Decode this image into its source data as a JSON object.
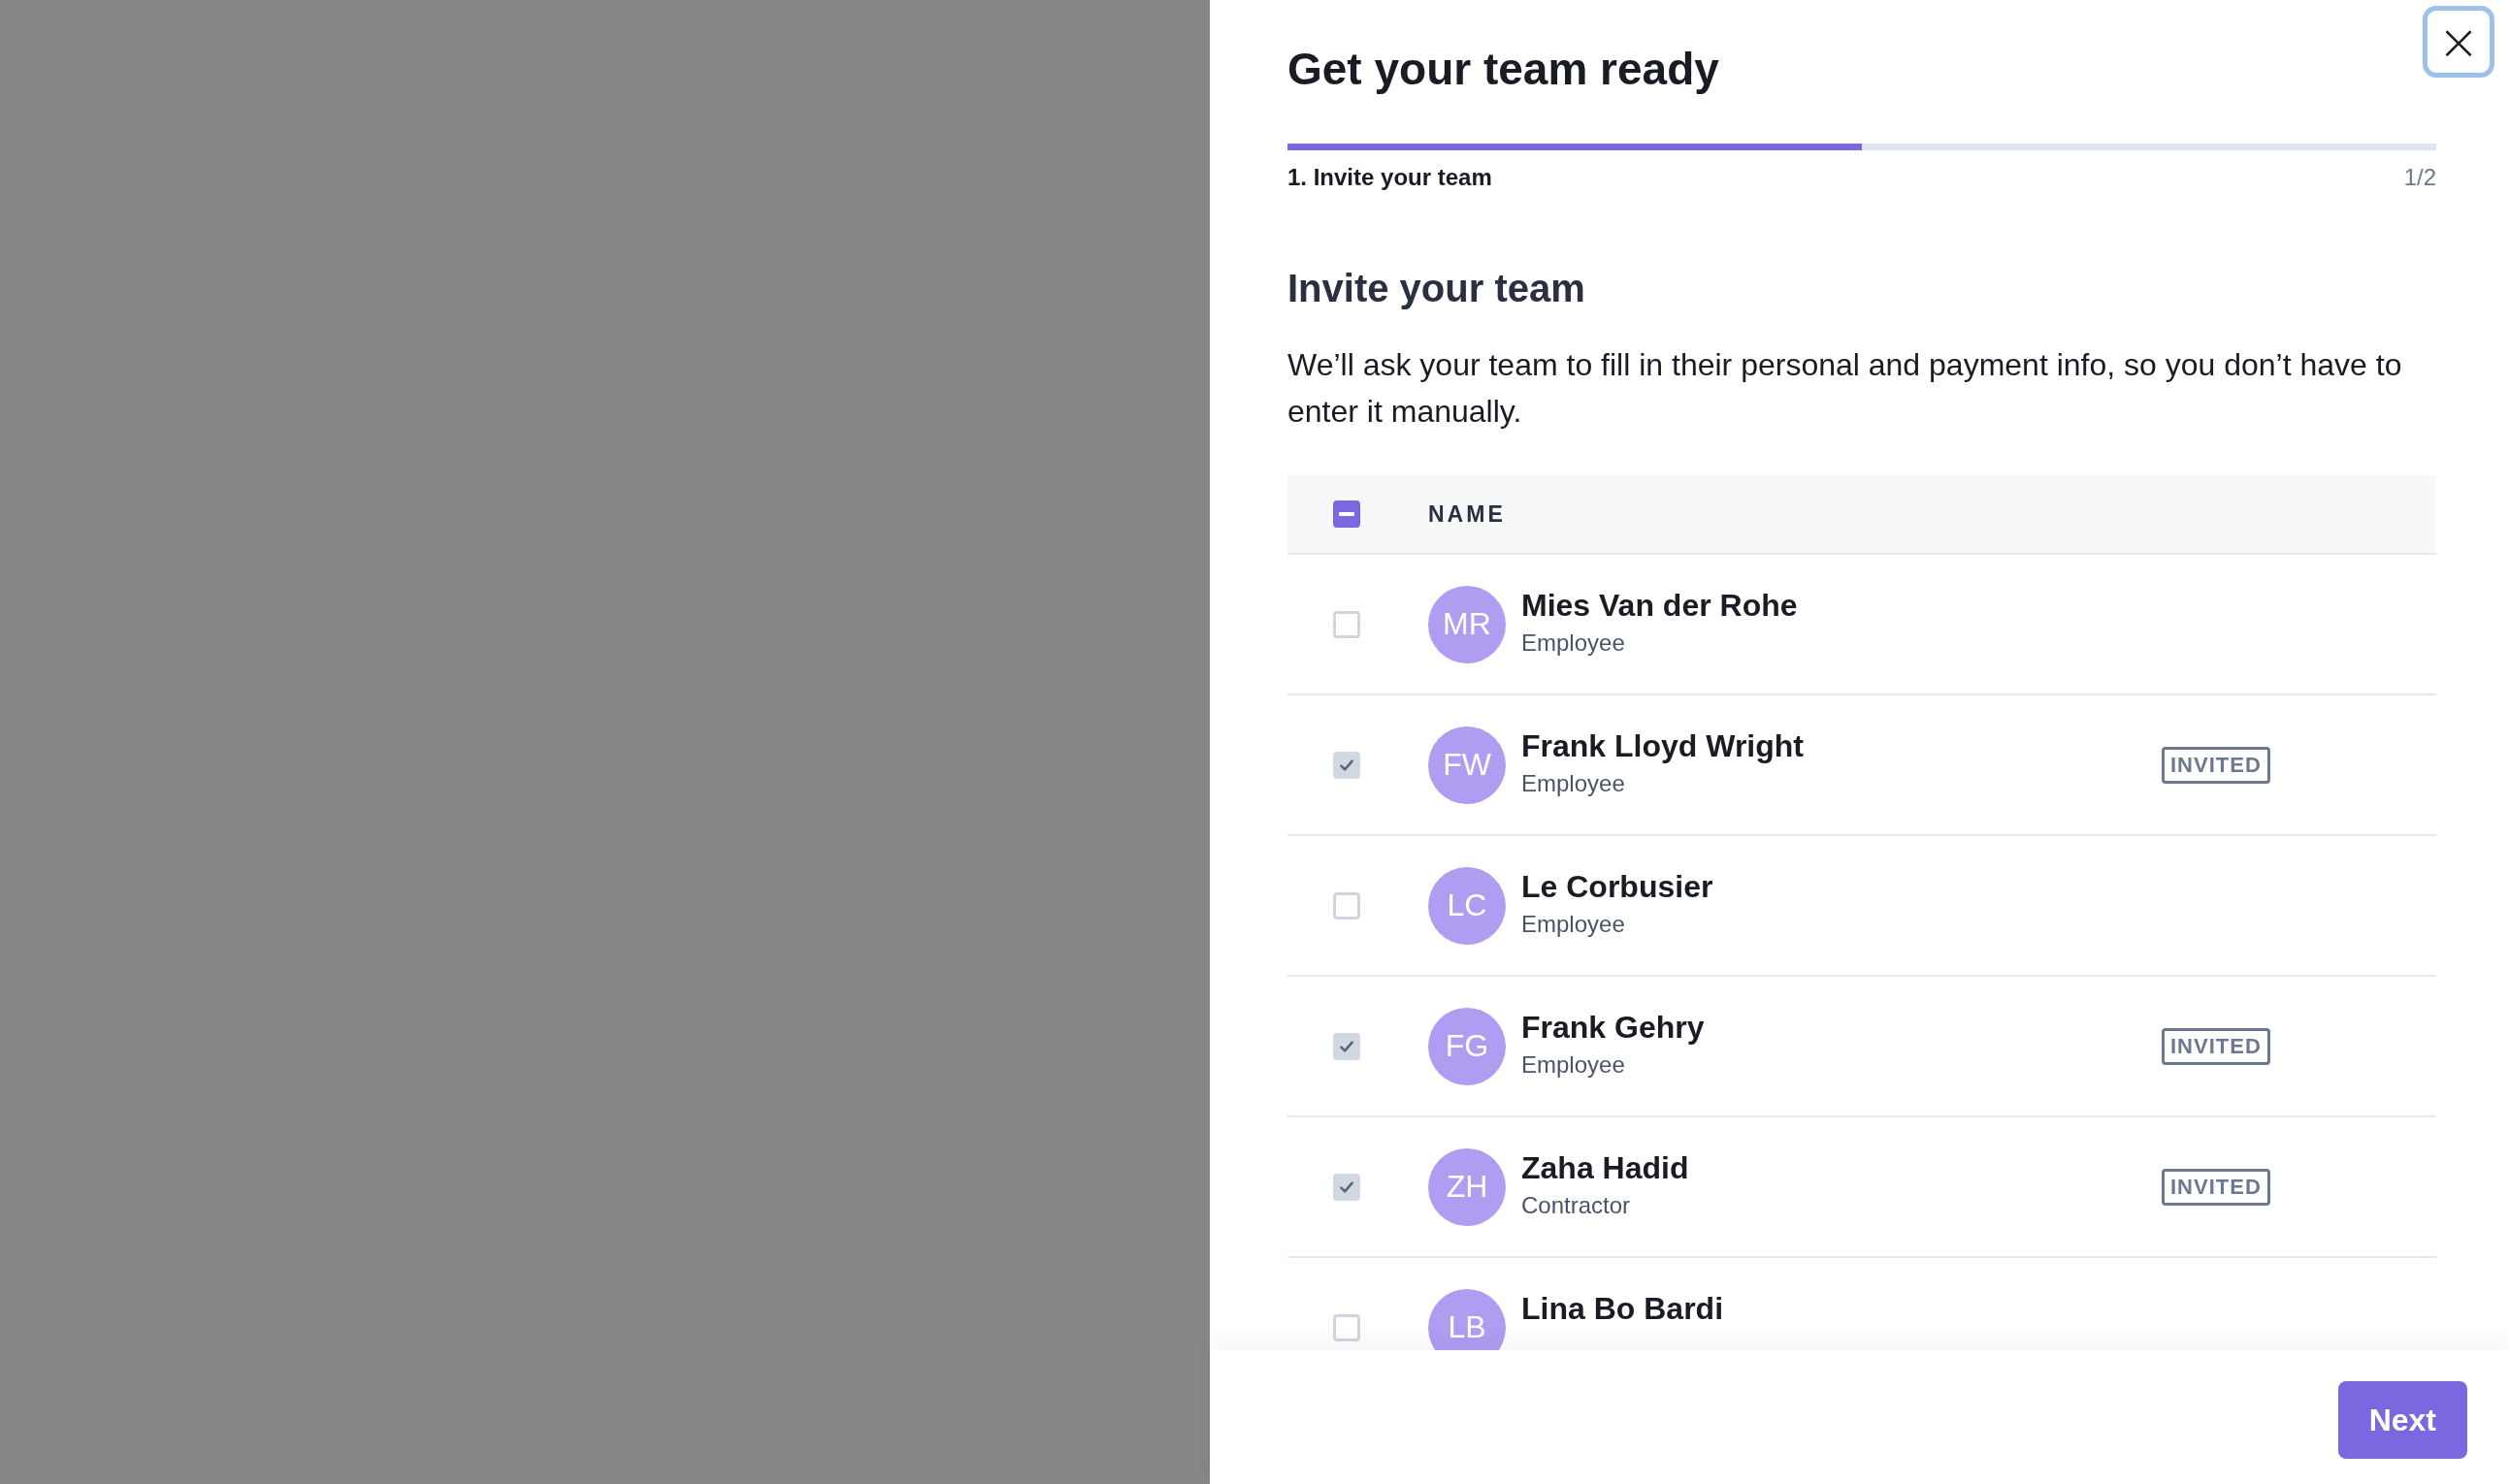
{
  "dialog": {
    "title": "Get your team ready",
    "close_label": "×"
  },
  "progress": {
    "level": 0.5,
    "step_label": "1. Invite your team",
    "step_count": "1/2"
  },
  "section": {
    "heading": "Invite your team",
    "description": "We’ll ask your team to fill in their personal and payment info, so you don’t have to enter it manually."
  },
  "table": {
    "header_checkbox": {
      "indeterminate": true
    },
    "column_1": "NAME",
    "rows": [
      {
        "initials": "MR",
        "name": "Mies Van der Rohe",
        "role": "Employee",
        "checked": false
      },
      {
        "initials": "FW",
        "name": "Frank Lloyd Wright",
        "role": "Employee",
        "checked": true,
        "badge": "INVITED"
      },
      {
        "initials": "LC",
        "name": "Le Corbusier",
        "role": "Employee",
        "checked": false
      },
      {
        "initials": "FG",
        "name": "Frank Gehry",
        "role": "Employee",
        "checked": true,
        "badge": "INVITED"
      },
      {
        "initials": "ZH",
        "name": "Zaha Hadid",
        "role": "Contractor",
        "checked": true,
        "badge": "INVITED"
      },
      {
        "initials": "LB",
        "name": "Lina Bo Bardi",
        "checked": false
      }
    ]
  },
  "footer": {
    "next_button": "Next"
  }
}
